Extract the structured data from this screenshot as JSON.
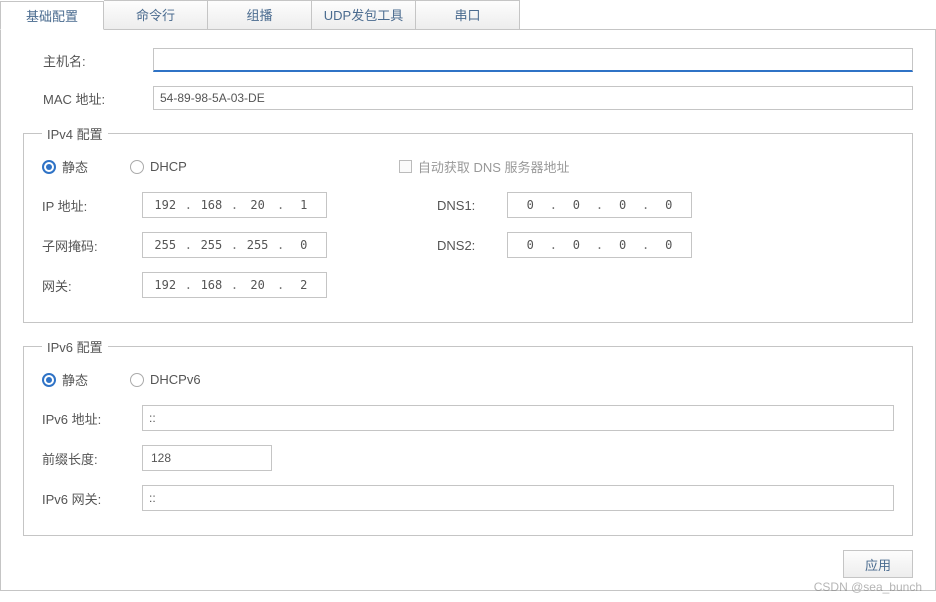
{
  "tabs": {
    "items": [
      "基础配置",
      "命令行",
      "组播",
      "UDP发包工具",
      "串口"
    ],
    "active": 0
  },
  "basic": {
    "hostname_label": "主机名:",
    "hostname_value": "",
    "mac_label": "MAC 地址:",
    "mac_value": "54-89-98-5A-03-DE"
  },
  "ipv4": {
    "legend": "IPv4 配置",
    "static_label": "静态",
    "dhcp_label": "DHCP",
    "auto_dns_label": "自动获取 DNS 服务器地址",
    "ip_label": "IP 地址:",
    "ip": [
      "192",
      "168",
      "20",
      "1"
    ],
    "mask_label": "子网掩码:",
    "mask": [
      "255",
      "255",
      "255",
      "0"
    ],
    "gw_label": "网关:",
    "gw": [
      "192",
      "168",
      "20",
      "2"
    ],
    "dns1_label": "DNS1:",
    "dns1": [
      "0",
      "0",
      "0",
      "0"
    ],
    "dns2_label": "DNS2:",
    "dns2": [
      "0",
      "0",
      "0",
      "0"
    ]
  },
  "ipv6": {
    "legend": "IPv6 配置",
    "static_label": "静态",
    "dhcp_label": "DHCPv6",
    "addr_label": "IPv6 地址:",
    "addr_value": "::",
    "prefix_label": "前缀长度:",
    "prefix_value": "128",
    "gw_label": "IPv6 网关:",
    "gw_value": "::"
  },
  "apply_label": "应用",
  "watermark": "CSDN @sea_bunch"
}
